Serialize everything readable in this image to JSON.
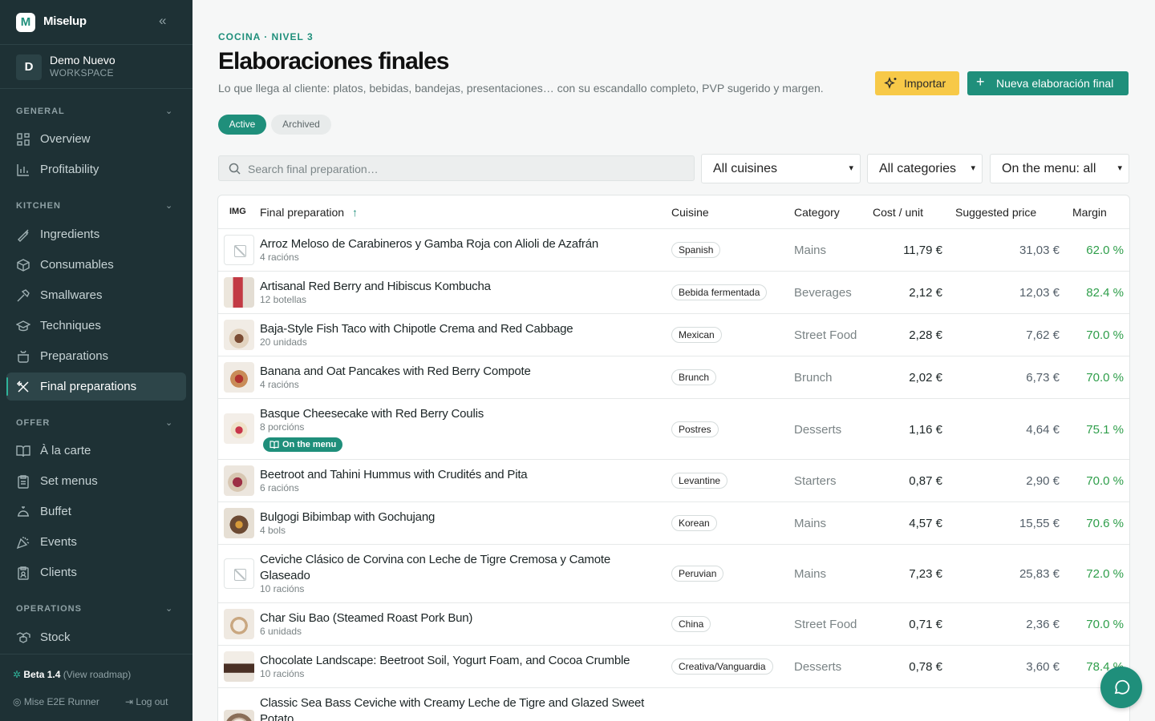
{
  "app": {
    "name": "Miselup",
    "logo_letter": "M"
  },
  "workspace": {
    "initial": "D",
    "name": "Demo Nuevo",
    "label": "WORKSPACE"
  },
  "sections": {
    "general": "GENERAL",
    "kitchen": "KITCHEN",
    "offer": "OFFER",
    "operations": "OPERATIONS"
  },
  "nav": {
    "overview": "Overview",
    "profitability": "Profitability",
    "ingredients": "Ingredients",
    "consumables": "Consumables",
    "smallwares": "Smallwares",
    "techniques": "Techniques",
    "preparations": "Preparations",
    "final_preparations": "Final preparations",
    "a_la_carte": "À la carte",
    "set_menus": "Set menus",
    "buffet": "Buffet",
    "events": "Events",
    "clients": "Clients",
    "stock": "Stock"
  },
  "footer": {
    "beta": "Beta 1.4",
    "roadmap": "(View roadmap)",
    "user": "Mise E2E Runner",
    "logout": "Log out"
  },
  "page": {
    "breadcrumb": "COCINA · NIVEL 3",
    "title": "Elaboraciones finales",
    "subtitle": "Lo que llega al cliente: platos, bebidas, bandejas, presentaciones… con su escandallo completo, PVP sugerido y margen.",
    "import_label": "Importar",
    "new_label": "Nueva elaboración final"
  },
  "tabs": {
    "active": "Active",
    "archived": "Archived"
  },
  "filters": {
    "search_placeholder": "Search final preparation…",
    "cuisine": "All cuisines",
    "category": "All categories",
    "menu": "On the menu: all"
  },
  "table": {
    "headers": {
      "img": "IMG",
      "name": "Final preparation",
      "cuisine": "Cuisine",
      "category": "Category",
      "cost": "Cost / unit",
      "price": "Suggested price",
      "margin": "Margin"
    },
    "on_menu_label": "On the menu",
    "rows": [
      {
        "name": "Arroz Meloso de Carabineros y Gamba Roja con Alioli de Azafrán",
        "yield": "4 racións",
        "cuisine": "Spanish",
        "category": "Mains",
        "cost": "11,79 €",
        "price": "31,03 €",
        "margin": "62.0 %"
      },
      {
        "name": "Artisanal Red Berry and Hibiscus Kombucha",
        "yield": "12 botellas",
        "cuisine": "Bebida fermentada",
        "category": "Beverages",
        "cost": "2,12 €",
        "price": "12,03 €",
        "margin": "82.4 %"
      },
      {
        "name": "Baja-Style Fish Taco with Chipotle Crema and Red Cabbage",
        "yield": "20 unidads",
        "cuisine": "Mexican",
        "category": "Street Food",
        "cost": "2,28 €",
        "price": "7,62 €",
        "margin": "70.0 %"
      },
      {
        "name": "Banana and Oat Pancakes with Red Berry Compote",
        "yield": "4 racións",
        "cuisine": "Brunch",
        "category": "Brunch",
        "cost": "2,02 €",
        "price": "6,73 €",
        "margin": "70.0 %"
      },
      {
        "name": "Basque Cheesecake with Red Berry Coulis",
        "yield": "8 porcións",
        "cuisine": "Postres",
        "category": "Desserts",
        "cost": "1,16 €",
        "price": "4,64 €",
        "margin": "75.1 %"
      },
      {
        "name": "Beetroot and Tahini Hummus with Crudités and Pita",
        "yield": "6 racións",
        "cuisine": "Levantine",
        "category": "Starters",
        "cost": "0,87 €",
        "price": "2,90 €",
        "margin": "70.0 %"
      },
      {
        "name": "Bulgogi Bibimbap with Gochujang",
        "yield": "4 bols",
        "cuisine": "Korean",
        "category": "Mains",
        "cost": "4,57 €",
        "price": "15,55 €",
        "margin": "70.6 %"
      },
      {
        "name": "Ceviche Clásico de Corvina con Leche de Tigre Cremosa y Camote Glaseado",
        "yield": "10 racións",
        "cuisine": "Peruvian",
        "category": "Mains",
        "cost": "7,23 €",
        "price": "25,83 €",
        "margin": "72.0 %"
      },
      {
        "name": "Char Siu Bao (Steamed Roast Pork Bun)",
        "yield": "6 unidads",
        "cuisine": "China",
        "category": "Street Food",
        "cost": "0,71 €",
        "price": "2,36 €",
        "margin": "70.0 %"
      },
      {
        "name": "Chocolate Landscape: Beetroot Soil, Yogurt Foam, and Cocoa Crumble",
        "yield": "10 racións",
        "cuisine": "Creativa/Vanguardia",
        "category": "Desserts",
        "cost": "0,78 €",
        "price": "3,60 €",
        "margin": "78.4 %"
      },
      {
        "name": "Classic Sea Bass Ceviche with Creamy Leche de Tigre and Glazed Sweet Potato",
        "yield": "",
        "cuisine": "",
        "category": "",
        "cost": "",
        "price": "",
        "margin": ""
      }
    ]
  },
  "colors": {
    "sidebar": "#1e3135",
    "accent": "#1f8f7b",
    "import": "#f7c948",
    "margin_good": "#2e9e4a"
  }
}
